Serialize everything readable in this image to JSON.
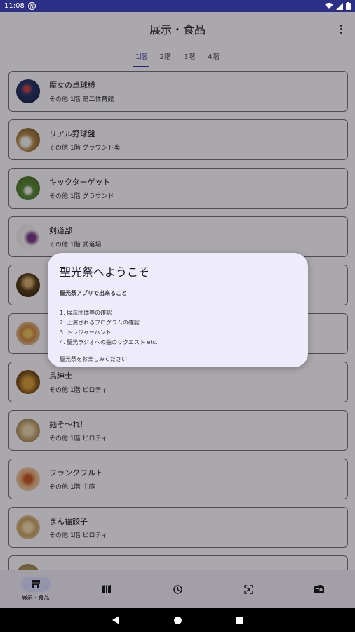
{
  "status_bar": {
    "time": "11:08",
    "app_badge": "N"
  },
  "app_bar": {
    "title": "展示・食品"
  },
  "tabs": [
    {
      "label": "1階",
      "active": true
    },
    {
      "label": "2階",
      "active": false
    },
    {
      "label": "3階",
      "active": false
    },
    {
      "label": "4階",
      "active": false
    }
  ],
  "items": [
    {
      "name": "魔女の卓球機",
      "location": "その他 1階 第二体育館"
    },
    {
      "name": "リアル野球盤",
      "location": "その他 1階 グラウンド奥"
    },
    {
      "name": "キックターゲット",
      "location": "その他 1階 グラウンド"
    },
    {
      "name": "剣道部",
      "location": "その他 1階 武道場"
    },
    {
      "name": "",
      "location": ""
    },
    {
      "name": "",
      "location": ""
    },
    {
      "name": "鳥紳士",
      "location": "その他 1階 ピロティ"
    },
    {
      "name": "麺そ〜れ!",
      "location": "その他 1階 ピロティ"
    },
    {
      "name": "フランクフルト",
      "location": "その他 1階 中庭"
    },
    {
      "name": "まん福餃子",
      "location": "その他 1階 ピロティ"
    },
    {
      "name": "",
      "location": ""
    }
  ],
  "dialog": {
    "title": "聖光祭へようこそ",
    "subtitle": "聖光祭アプリで出来ること",
    "list": [
      "1. 展示団体等の確認",
      "2. 上演されるプログラムの確認",
      "3. トレジャーハント",
      "4. 聖光ラジオへの曲のリクエスト etc."
    ],
    "footer": "聖光祭をお楽しみください!"
  },
  "bottom_nav": [
    {
      "label": "展示・食品",
      "icon": "store-icon",
      "active": true
    },
    {
      "label": "",
      "icon": "map-icon",
      "active": false
    },
    {
      "label": "",
      "icon": "clock-icon",
      "active": false
    },
    {
      "label": "",
      "icon": "hunt-icon",
      "active": false
    },
    {
      "label": "",
      "icon": "radio-icon",
      "active": false
    }
  ],
  "colors": {
    "accent": "#3f3aa5",
    "status_bar": "#2b2f86",
    "dialog_bg": "#eeebfa"
  }
}
